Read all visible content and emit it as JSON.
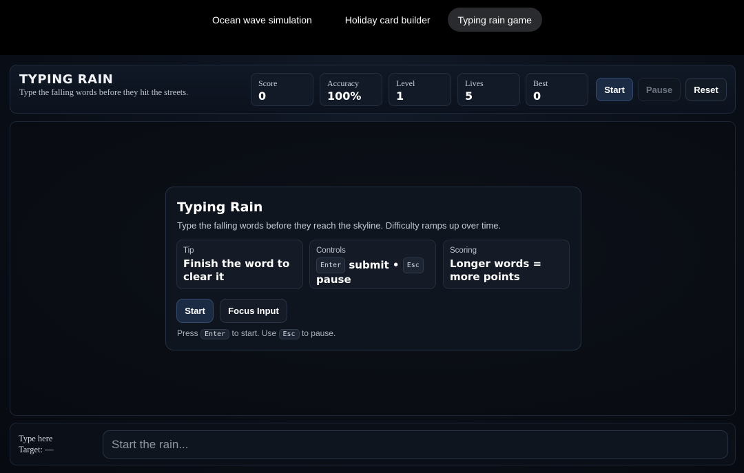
{
  "tabs": [
    {
      "label": "Ocean wave simulation",
      "active": false
    },
    {
      "label": "Holiday card builder",
      "active": false
    },
    {
      "label": "Typing rain game",
      "active": true
    }
  ],
  "header": {
    "title": "TYPING RAIN",
    "subtitle": "Type the falling words before they hit the streets.",
    "stats": {
      "score": {
        "label": "Score",
        "value": "0"
      },
      "accuracy": {
        "label": "Accuracy",
        "value": "100%"
      },
      "level": {
        "label": "Level",
        "value": "1"
      },
      "lives": {
        "label": "Lives",
        "value": "5"
      },
      "best": {
        "label": "Best",
        "value": "0"
      }
    },
    "buttons": {
      "start": "Start",
      "pause": "Pause",
      "reset": "Reset"
    }
  },
  "modal": {
    "title": "Typing Rain",
    "subtitle": "Type the falling words before they reach the skyline. Difficulty ramps up over time.",
    "tip": {
      "label": "Tip",
      "body": "Finish the word to clear it"
    },
    "controls": {
      "label": "Controls",
      "enter_key": "Enter",
      "submit": "submit",
      "sep": "•",
      "esc_key": "Esc",
      "pause": "pause"
    },
    "scoring": {
      "label": "Scoring",
      "body": "Longer words = more points"
    },
    "buttons": {
      "start": "Start",
      "focus": "Focus Input"
    },
    "hint": {
      "press": "Press",
      "enter_key": "Enter",
      "to_start": "to start. Use",
      "esc_key": "Esc",
      "to_pause": "to pause."
    }
  },
  "input": {
    "label": "Type here",
    "target_label": "Target:",
    "target_value": "—",
    "placeholder": "Start the rain..."
  },
  "colors": {
    "accent_button": "#1b2b44",
    "background": "#0a0f18"
  }
}
